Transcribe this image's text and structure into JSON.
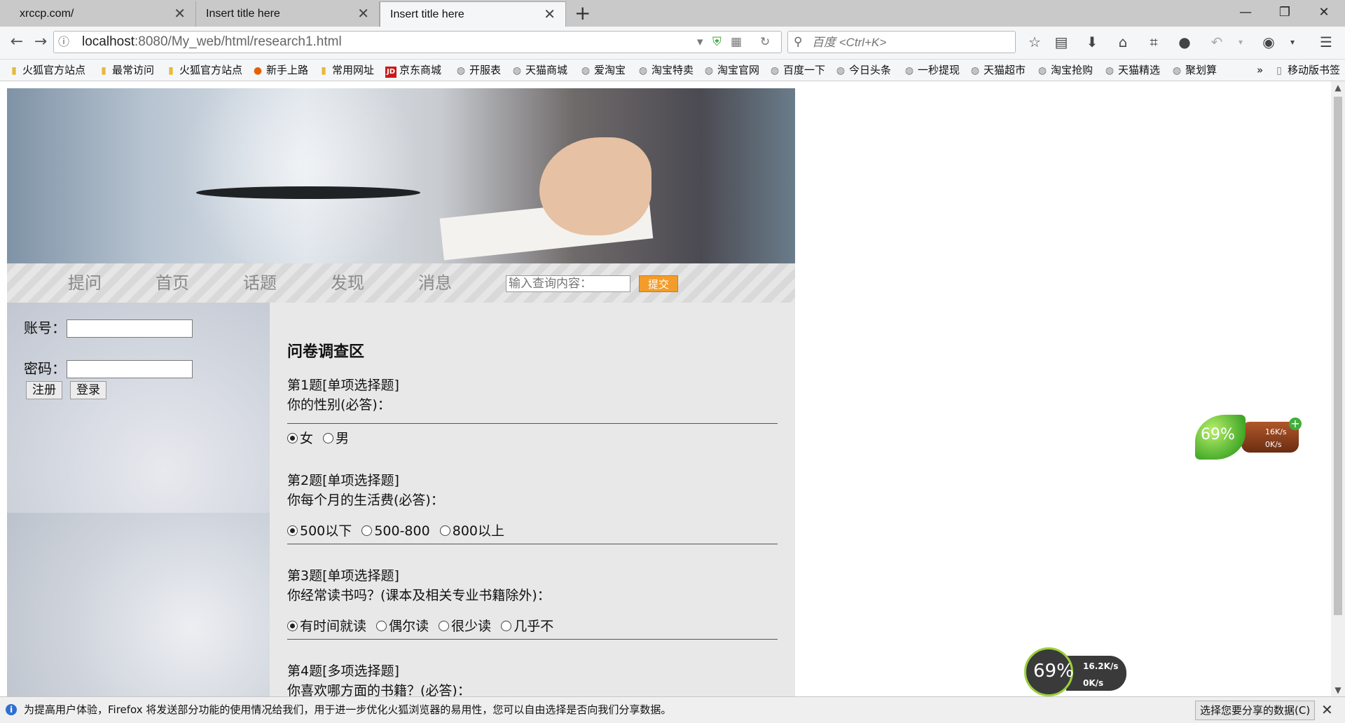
{
  "tabs": [
    {
      "title": "xrccp.com/",
      "active": false
    },
    {
      "title": "Insert title here",
      "active": false
    },
    {
      "title": "Insert title here",
      "active": true
    }
  ],
  "urlbar": {
    "host": "localhost",
    "path": ":8080/My_web/html/research1.html"
  },
  "search": {
    "placeholder": "百度 <Ctrl+K>"
  },
  "bookmarks": [
    {
      "label": "火狐官方站点",
      "icon": "folder-icon"
    },
    {
      "label": "最常访问",
      "icon": "folder-icon"
    },
    {
      "label": "火狐官方站点",
      "icon": "folder-icon"
    },
    {
      "label": "新手上路",
      "icon": "firefox-icon"
    },
    {
      "label": "常用网址",
      "icon": "folder-icon"
    },
    {
      "label": "京东商城",
      "icon": "jd-icon"
    },
    {
      "label": "开服表",
      "icon": "globe-icon"
    },
    {
      "label": "天猫商城",
      "icon": "globe-icon"
    },
    {
      "label": "爱淘宝",
      "icon": "globe-icon"
    },
    {
      "label": "淘宝特卖",
      "icon": "globe-icon"
    },
    {
      "label": "淘宝官网",
      "icon": "globe-icon"
    },
    {
      "label": "百度一下",
      "icon": "globe-icon"
    },
    {
      "label": "今日头条",
      "icon": "globe-icon"
    },
    {
      "label": "一秒提现",
      "icon": "globe-icon"
    },
    {
      "label": "天猫超市",
      "icon": "globe-icon"
    },
    {
      "label": "淘宝抢购",
      "icon": "globe-icon"
    },
    {
      "label": "天猫精选",
      "icon": "globe-icon"
    },
    {
      "label": "聚划算",
      "icon": "globe-icon"
    }
  ],
  "bookmarks_more": "»",
  "mobile_bookmarks": "移动版书签",
  "menu": {
    "items": [
      "提问",
      "首页",
      "话题",
      "发现",
      "消息"
    ],
    "search_placeholder": "输入查询内容：",
    "submit": "提交"
  },
  "login": {
    "account_label": "账号：",
    "password_label": "密码：",
    "register": "注册",
    "login": "登录"
  },
  "survey": {
    "title": "问卷调查区",
    "questions": [
      {
        "header": "第1题[单项选择题]",
        "text": "你的性别(必答)：",
        "options": [
          "女",
          "男"
        ],
        "selected": 0
      },
      {
        "header": "第2题[单项选择题]",
        "text": "你每个月的生活费(必答)：",
        "options": [
          "500以下",
          "500-800",
          "800以上"
        ],
        "selected": 0
      },
      {
        "header": "第3题[单项选择题]",
        "text": "你经常读书吗？(课本及相关专业书籍除外)：",
        "options": [
          "有时间就读",
          "偶尔读",
          "很少读",
          "几乎不"
        ],
        "selected": 0
      },
      {
        "header": "第4题[多项选择题]",
        "text": "你喜欢哪方面的书籍？(必答)：",
        "options": [],
        "selected": -1
      }
    ]
  },
  "widgets": {
    "leaf": {
      "percent": "69%",
      "up": "16K/s",
      "down": "0K/s"
    },
    "speed": {
      "percent": "69%",
      "up": "16.2K/s",
      "down": "0K/s"
    }
  },
  "notification": {
    "message": "为提高用户体验，Firefox 将发送部分功能的使用情况给我们，用于进一步优化火狐浏览器的易用性，您可以自由选择是否向我们分享数据。",
    "button": "选择您要分享的数据(C)"
  }
}
